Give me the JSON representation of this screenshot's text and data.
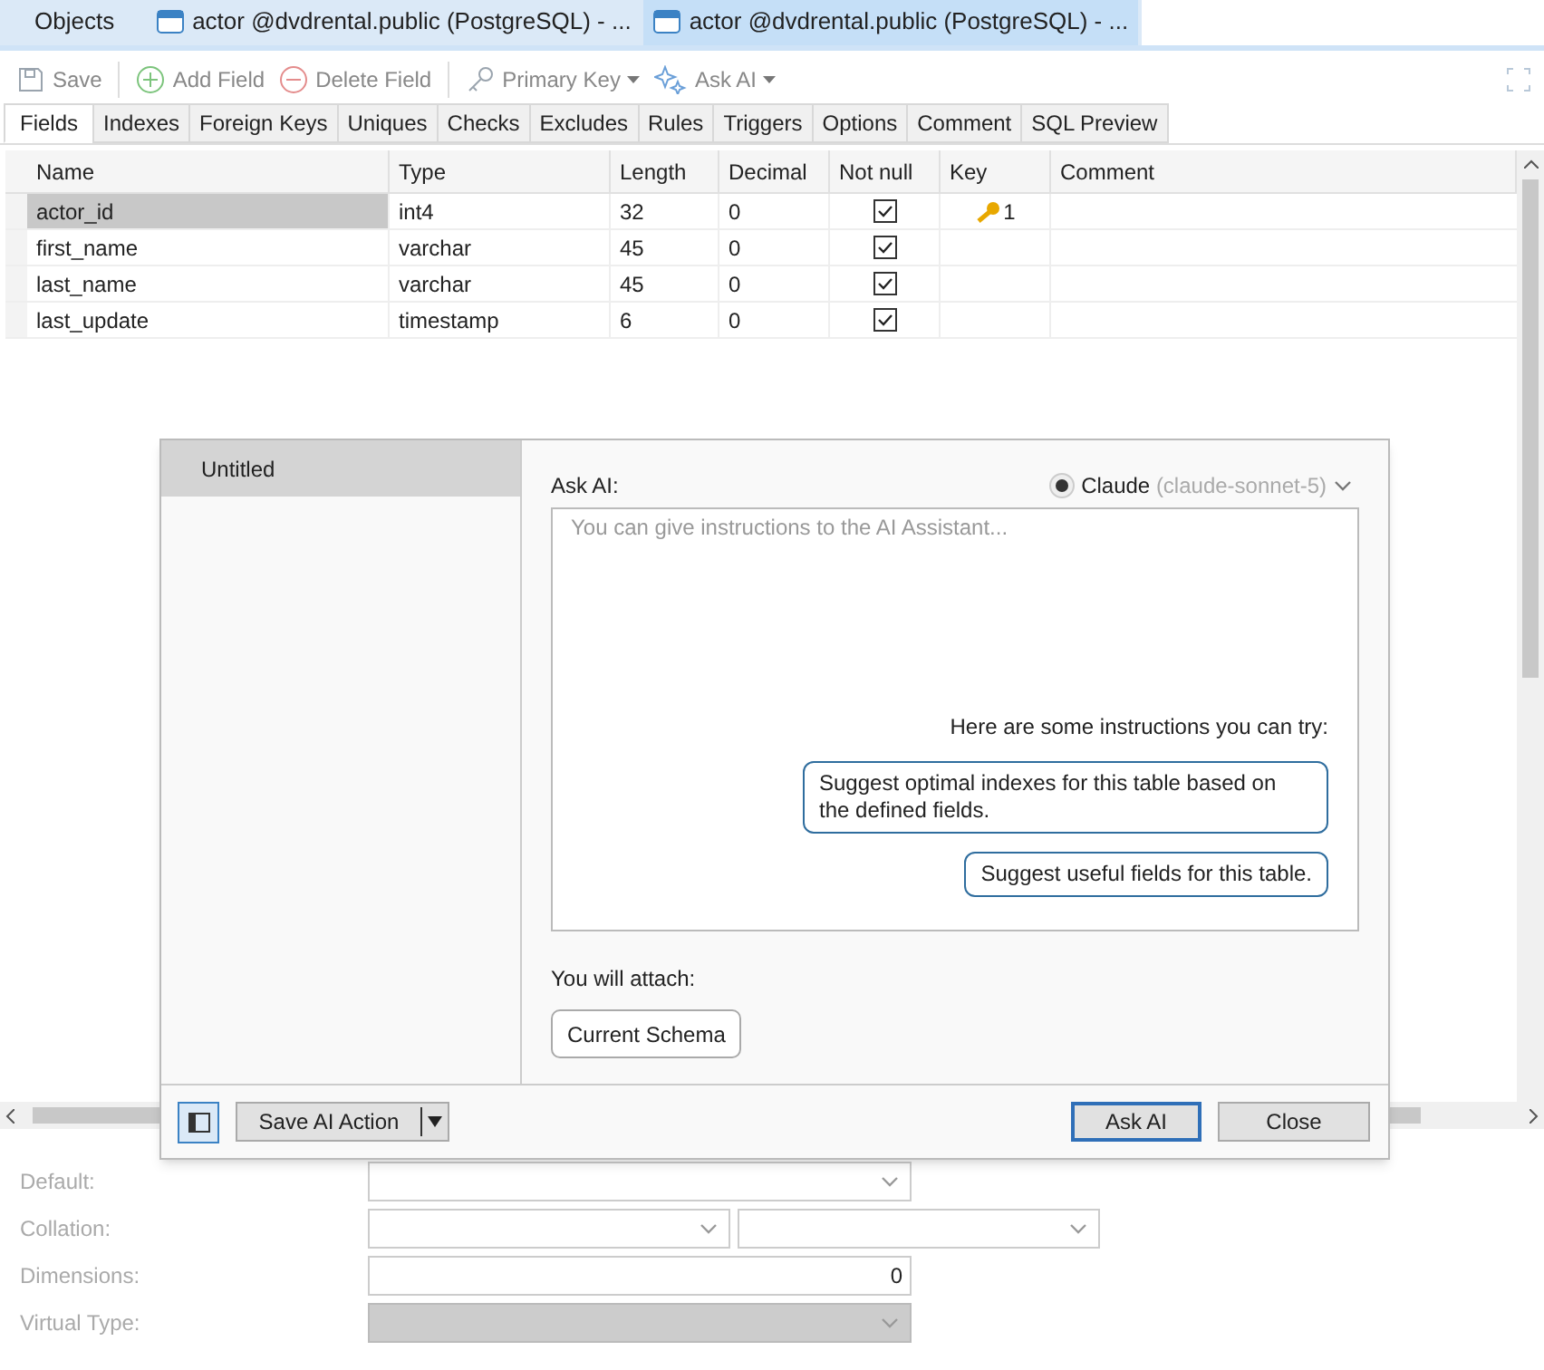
{
  "doc_tabs": [
    {
      "label": "Objects",
      "icon": false,
      "selected": false
    },
    {
      "label": "actor @dvdrental.public (PostgreSQL) - ...",
      "icon": true,
      "selected": false
    },
    {
      "label": "actor @dvdrental.public (PostgreSQL) - ...",
      "icon": true,
      "selected": true
    }
  ],
  "toolbar": [
    {
      "kind": "save",
      "label": "Save"
    },
    {
      "kind": "add",
      "label": "Add Field"
    },
    {
      "kind": "delete",
      "label": "Delete Field"
    },
    {
      "kind": "key",
      "label": "Primary Key"
    },
    {
      "kind": "ai",
      "label": "Ask AI"
    }
  ],
  "tabs": [
    {
      "label": "Fields",
      "selected": true
    },
    {
      "label": "Indexes",
      "selected": false
    },
    {
      "label": "Foreign Keys",
      "selected": false
    },
    {
      "label": "Uniques",
      "selected": false
    },
    {
      "label": "Checks",
      "selected": false
    },
    {
      "label": "Excludes",
      "selected": false
    },
    {
      "label": "Rules",
      "selected": false
    },
    {
      "label": "Triggers",
      "selected": false
    },
    {
      "label": "Options",
      "selected": false
    },
    {
      "label": "Comment",
      "selected": false
    },
    {
      "label": "SQL Preview",
      "selected": false
    }
  ],
  "table": {
    "columns": [
      "Name",
      "Type",
      "Length",
      "Decimal",
      "Not null",
      "Key",
      "Comment"
    ],
    "rows": [
      {
        "name": "actor_id",
        "type": "int4",
        "length": "32",
        "decimal": "0",
        "not_null": true,
        "key": "1",
        "selected": true
      },
      {
        "name": "first_name",
        "type": "varchar",
        "length": "45",
        "decimal": "0",
        "not_null": true,
        "selected": false
      },
      {
        "name": "last_name",
        "type": "varchar",
        "length": "45",
        "decimal": "0",
        "not_null": true,
        "selected": false
      },
      {
        "name": "last_update",
        "type": "timestamp",
        "length": "6",
        "decimal": "0",
        "not_null": true,
        "selected": false
      }
    ]
  },
  "properties": [
    {
      "label": "Default:",
      "kind": "combo"
    },
    {
      "label": "Collation:",
      "kind": "double_combo"
    },
    {
      "label": "Dimensions:",
      "kind": "number",
      "value": "0"
    },
    {
      "label": "Virtual Type:",
      "kind": "disabled_combo"
    }
  ],
  "dialog": {
    "sidebar_items": [
      {
        "label": "Untitled",
        "selected": true
      }
    ],
    "ask_label": "Ask AI:",
    "provider": "Claude",
    "model": "(claude-sonnet-5)",
    "placeholder": "You can give instructions to the AI Assistant...",
    "suggestions_title": "Here are some instructions you can try:",
    "suggestions": [
      "Suggest optimal indexes for this table based on the defined fields.",
      "Suggest useful fields for this table."
    ],
    "attach_label": "You will attach:",
    "attachments": [
      "Current Schema"
    ],
    "save_action": "Save AI Action",
    "ask_button": "Ask AI",
    "close_button": "Close"
  }
}
